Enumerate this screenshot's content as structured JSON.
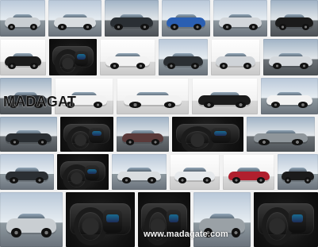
{
  "collage": {
    "top_overlay_text": "MADAGAT",
    "bottom_overlay_text": "www.madagate.com"
  },
  "colors": {
    "car_silver": "#c9ced2",
    "car_black": "#1b1b1b",
    "car_white": "#f2f2f2",
    "car_blue": "#2a5fb3",
    "car_red": "#b01f2e",
    "car_gray": "#8f969b"
  }
}
